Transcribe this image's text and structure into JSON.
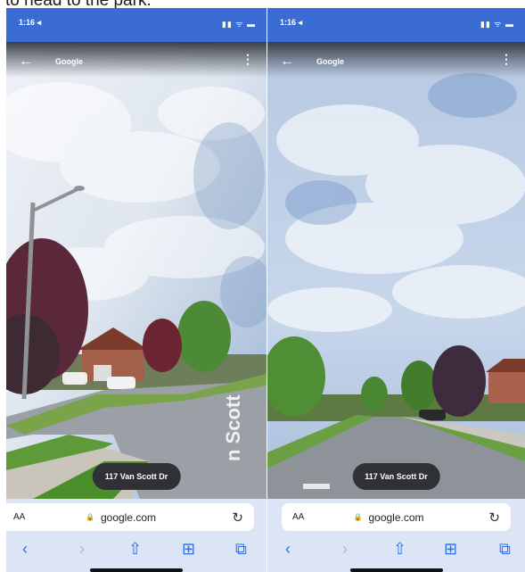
{
  "caption": "to head to the park.",
  "screens": [
    {
      "status_time": "1:16 ◂",
      "status_icons": "▮▮ ᯤ ▬",
      "top_bar_title": "Google",
      "address": "117 Van Scott Dr",
      "street_sign_text": "n Scott",
      "browser": {
        "aa": "AA",
        "lock": "🔒",
        "url": "google.com",
        "reload": "↻"
      },
      "toolbar": {
        "back": "‹",
        "forward": "›",
        "share": "⇧",
        "bookmarks": "⊞",
        "tabs": "⧉"
      }
    },
    {
      "status_time": "1:16 ◂",
      "status_icons": "▮▮ ᯤ ▬",
      "top_bar_title": "Google",
      "address": "117 Van Scott Dr",
      "browser": {
        "aa": "AA",
        "lock": "🔒",
        "url": "google.com",
        "reload": "↻"
      },
      "toolbar": {
        "back": "‹",
        "forward": "›",
        "share": "⇧",
        "bookmarks": "⊞",
        "tabs": "⧉"
      }
    }
  ]
}
